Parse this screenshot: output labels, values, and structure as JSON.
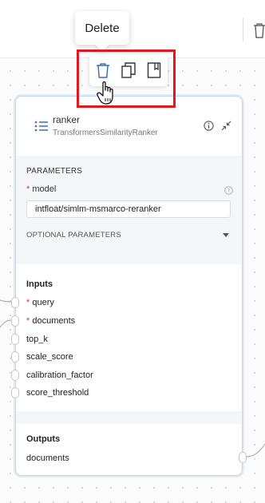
{
  "tooltip": {
    "text": "Delete"
  },
  "action_bar": {
    "delete_icon": "trash-icon",
    "duplicate_icon": "copy-icon",
    "docs_icon": "book-icon"
  },
  "topbar": {
    "icon": "trash-icon"
  },
  "node": {
    "title": "ranker",
    "subtitle": "TransformersSimilarityRanker",
    "header_icon": "list-icon",
    "parameters": {
      "section_label": "PARAMETERS",
      "model_required_mark": "*",
      "model_label": "model",
      "model_value": "intfloat/simlm-msmarco-reranker",
      "optional_label": "OPTIONAL PARAMETERS"
    },
    "inputs": {
      "title": "Inputs",
      "items": [
        {
          "name": "query",
          "required": "*"
        },
        {
          "name": "documents",
          "required": "*"
        },
        {
          "name": "top_k",
          "required": ""
        },
        {
          "name": "scale_score",
          "required": ""
        },
        {
          "name": "calibration_factor",
          "required": ""
        },
        {
          "name": "score_threshold",
          "required": ""
        }
      ]
    },
    "outputs": {
      "title": "Outputs",
      "items": [
        {
          "name": "documents"
        }
      ]
    }
  },
  "colors": {
    "highlight": "#e5161d",
    "node_border": "#bfd6f2",
    "required": "#e0342b",
    "accent_icon": "#3b6fb6"
  }
}
